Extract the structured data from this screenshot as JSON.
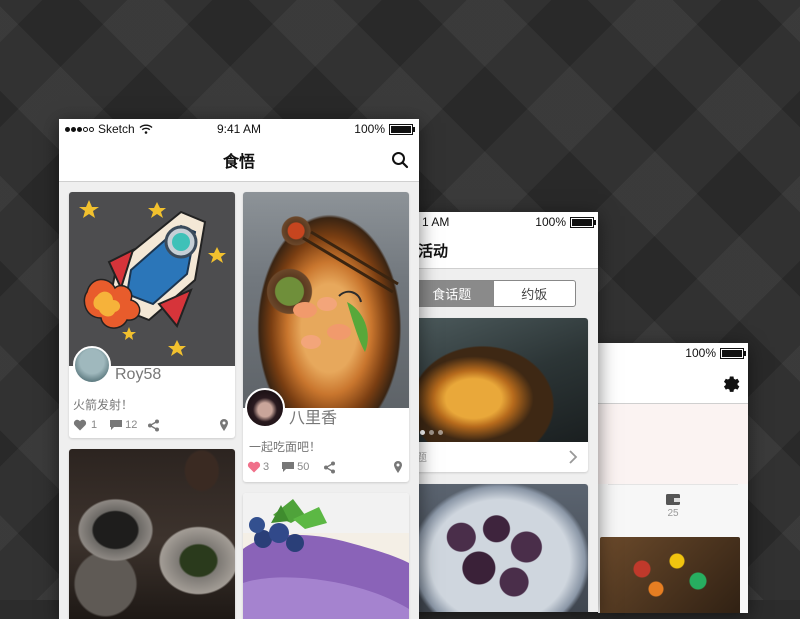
{
  "app": {
    "title": "食悟"
  },
  "status": {
    "carrier": "Sketch",
    "time": "9:41 AM",
    "battery": "100%"
  },
  "feed": {
    "cards": [
      {
        "username": "Roy58",
        "caption": "火箭发射！",
        "likes": "1",
        "comments": "12"
      },
      {
        "username": "八里香",
        "caption": "一起吃面吧！",
        "likes": "3",
        "comments": "50"
      }
    ]
  },
  "screen2": {
    "time": "1 AM",
    "battery": "100%",
    "title": "活动",
    "tabs": [
      {
        "label": "食话题",
        "selected": true
      },
      {
        "label": "约饭",
        "selected": false
      }
    ],
    "card1_caption": "题"
  },
  "screen3": {
    "battery": "100%",
    "count": "25"
  },
  "colors": {
    "heart": "#f0708a",
    "accent": "#111111",
    "muted": "#888888"
  }
}
